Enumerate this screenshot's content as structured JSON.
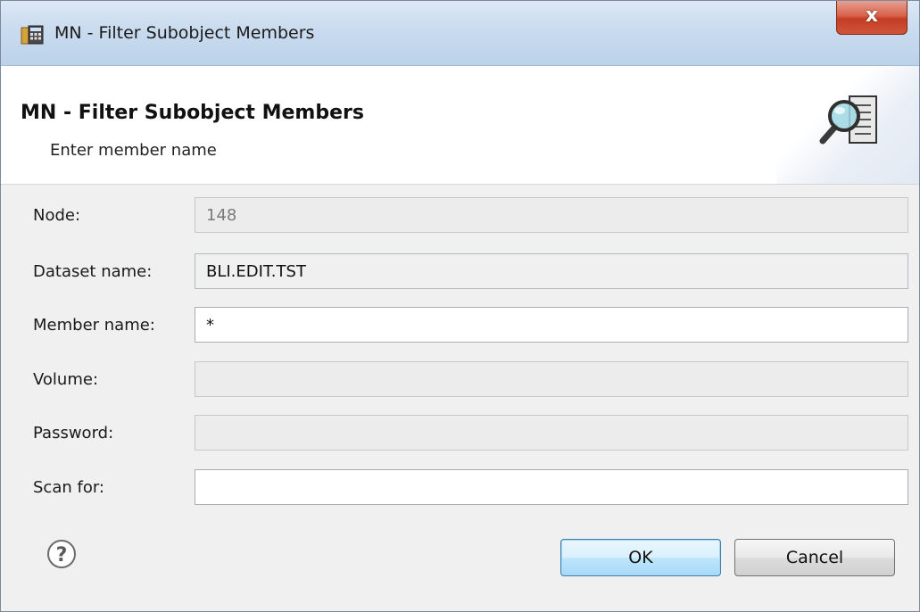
{
  "window": {
    "title": "MN - Filter Subobject Members",
    "close_glyph": "x",
    "app_icon": "calculator-icon"
  },
  "banner": {
    "title": "MN - Filter Subobject Members",
    "subtitle": "Enter member name",
    "icon": "magnifier-document-icon"
  },
  "fields": [
    {
      "label": "Node:",
      "value": "148",
      "state": "disabled"
    },
    {
      "label": "Dataset name:",
      "value": "BLI.EDIT.TST",
      "state": "readonly"
    },
    {
      "label": "Member name:",
      "value": "*",
      "state": "enabled"
    },
    {
      "label": "Volume:",
      "value": "",
      "state": "disabled"
    },
    {
      "label": "Password:",
      "value": "",
      "state": "disabled"
    },
    {
      "label": "Scan for:",
      "value": "",
      "state": "enabled"
    }
  ],
  "buttons": {
    "ok": "OK",
    "cancel": "Cancel"
  },
  "help": {
    "glyph": "?",
    "icon": "help-icon"
  },
  "colors": {
    "titlebar": "#c9dbee",
    "close": "#c33d23",
    "default_button": "#bee6fd",
    "dialog_bg": "#f0f0f0"
  }
}
